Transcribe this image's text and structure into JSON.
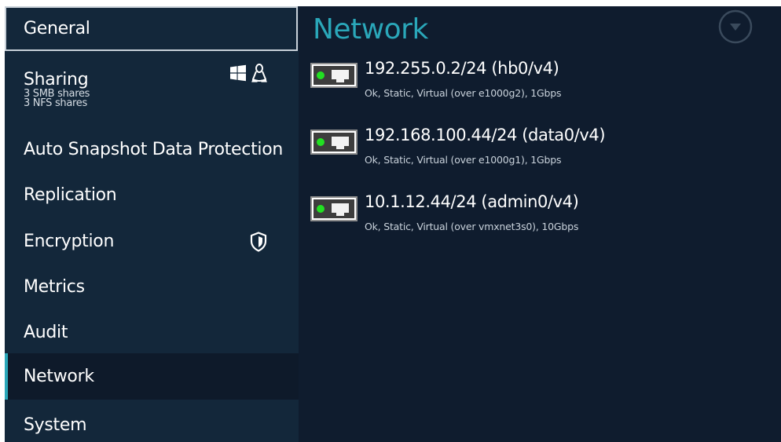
{
  "sidebar": {
    "general": "General",
    "sharing": {
      "label": "Sharing",
      "smb": "3 SMB shares",
      "nfs": "3 NFS shares"
    },
    "auto_snapshot": "Auto Snapshot Data Protection",
    "replication": "Replication",
    "encryption": "Encryption",
    "metrics": "Metrics",
    "audit": "Audit",
    "network": "Network",
    "system": "System",
    "selected": "Network"
  },
  "main": {
    "title": "Network",
    "interfaces": [
      {
        "address": "192.255.0.2/24 (hb0/v4)",
        "details": "Ok, Static, Virtual (over e1000g2), 1Gbps",
        "status": "ok"
      },
      {
        "address": "192.168.100.44/24 (data0/v4)",
        "details": "Ok, Static, Virtual (over e1000g1), 1Gbps",
        "status": "ok"
      },
      {
        "address": "10.1.12.44/24 (admin0/v4)",
        "details": "Ok, Static, Virtual (over vmxnet3s0), 10Gbps",
        "status": "ok"
      }
    ]
  },
  "icons": {
    "sharing": [
      "windows-icon",
      "linux-icon"
    ],
    "encryption": "shield-icon",
    "collapse": "chevron-down-circle-icon",
    "interface": "network-adapter-icon"
  },
  "colors": {
    "background": "#0f1c2e",
    "sidebar": "#13273a",
    "accent": "#2aa7b9",
    "status_ok": "#22e022"
  }
}
